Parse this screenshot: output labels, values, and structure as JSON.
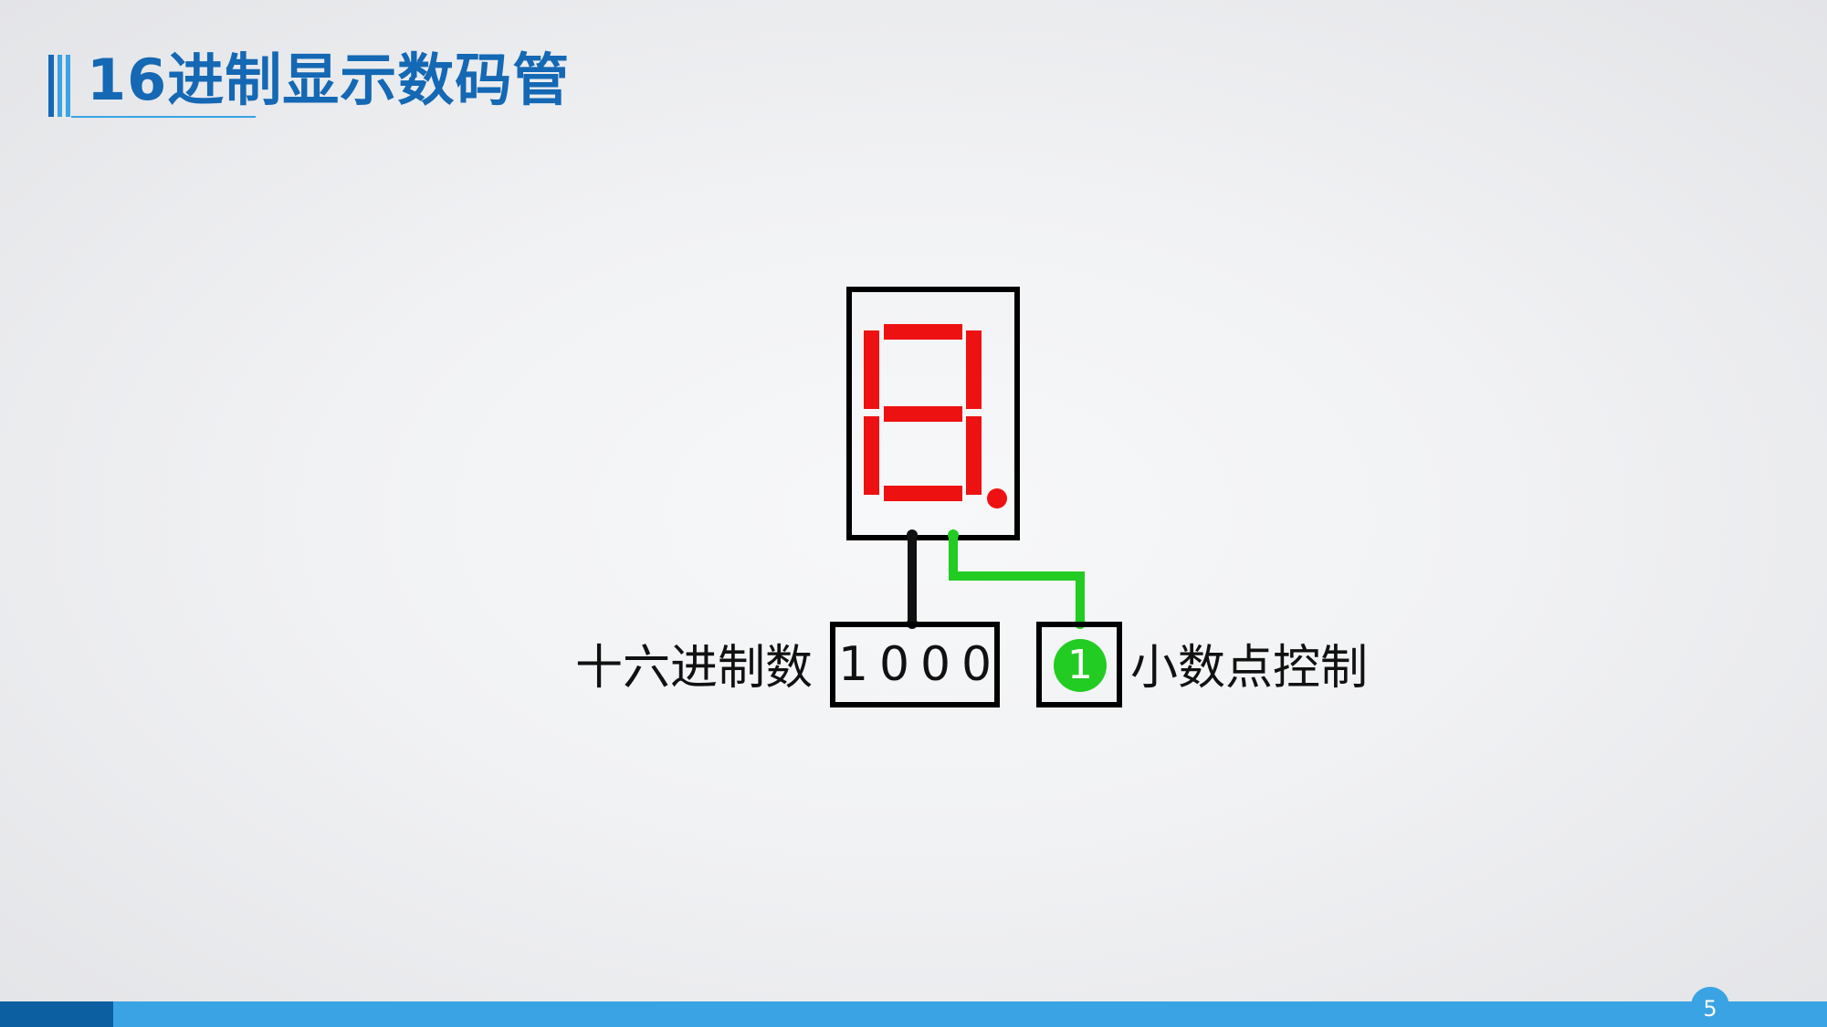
{
  "slide": {
    "title": "16进制显示数码管",
    "page_number": "5"
  },
  "diagram": {
    "hex_label": "十六进制数",
    "hex_digits": [
      "1",
      "0",
      "0",
      "0"
    ],
    "dp_label": "小数点控制",
    "dp_value": "1",
    "segment_color": "#ee1111",
    "wire_color_dp": "#22cc22",
    "wire_color_hex": "#111111",
    "accent_color": "#1468b4"
  }
}
